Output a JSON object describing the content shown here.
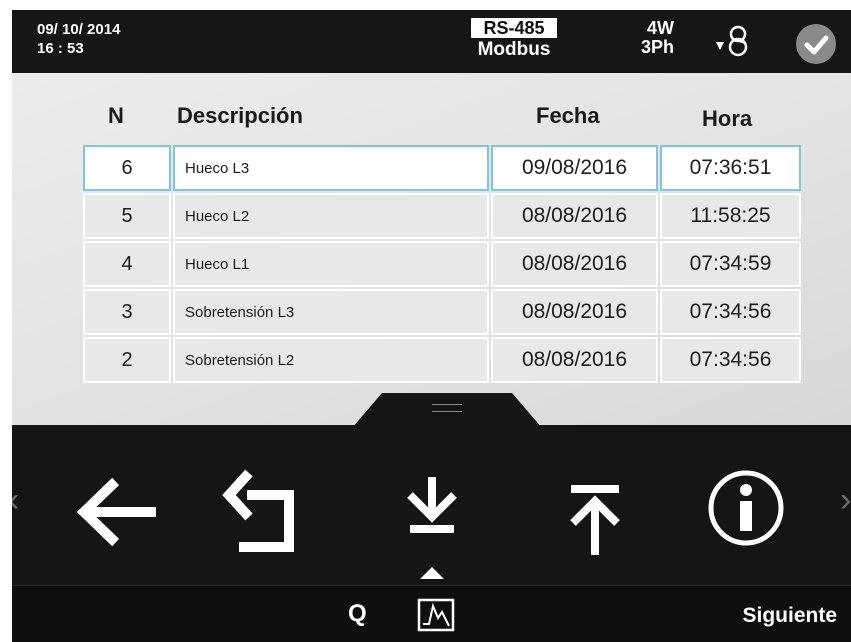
{
  "status": {
    "date": "09/ 10/ 2014",
    "time": "16 : 53",
    "protocol": "RS-485",
    "mode": "Modbus",
    "wiring": "4W",
    "phases": "3Ph",
    "indicator_icon": "check-circle-icon",
    "link_icon": "loop-arrow-icon"
  },
  "table": {
    "headers": {
      "n": "N",
      "desc": "Descripción",
      "date": "Fecha",
      "time": "Hora"
    },
    "rows": [
      {
        "n": "6",
        "desc": "Hueco L3",
        "date": "09/08/2016",
        "time": "07:36:51",
        "selected": true
      },
      {
        "n": "5",
        "desc": "Hueco L2",
        "date": "08/08/2016",
        "time": "11:58:25"
      },
      {
        "n": "4",
        "desc": "Hueco L1",
        "date": "08/08/2016",
        "time": "07:34:59"
      },
      {
        "n": "3",
        "desc": "Sobretensión L3",
        "date": "08/08/2016",
        "time": "07:34:56"
      },
      {
        "n": "2",
        "desc": " Sobretensión L2",
        "date": "08/08/2016",
        "time": "07:34:56"
      }
    ]
  },
  "toolbar": {
    "icons": [
      "arrow-left-icon",
      "undo-icon",
      "scroll-bottom-icon",
      "scroll-top-icon",
      "info-icon"
    ]
  },
  "footer": {
    "q_label": "Q",
    "waveform_icon": "waveform-icon",
    "next_label": "Siguiente"
  },
  "colors": {
    "selected_border": "#7fc7d8",
    "bar_bg": "#161616",
    "content_bg": "#e6e6e6"
  }
}
